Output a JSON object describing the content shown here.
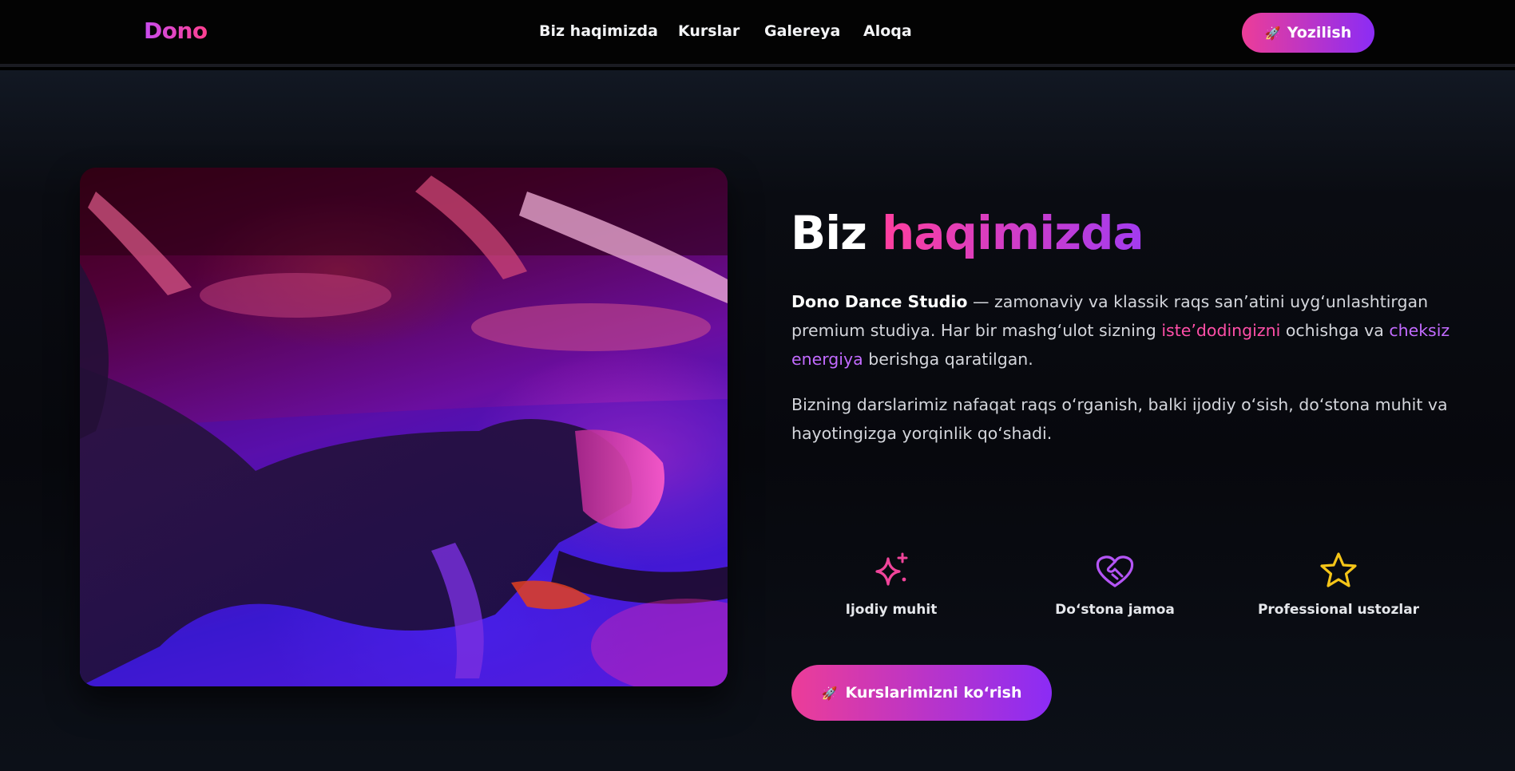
{
  "brand": {
    "name": "Dono",
    "gradient": [
      "#c84cf0",
      "#ff3f8e"
    ]
  },
  "nav": {
    "items": [
      "Biz haqimizda",
      "Kurslar",
      "Galereya",
      "Aloqa"
    ]
  },
  "header_button": {
    "icon": "rocket-icon",
    "emoji": "🚀",
    "label": "Yozilish"
  },
  "about": {
    "title_plain": "Biz ",
    "title_accent": "haqimizda",
    "paragraph1": {
      "strong": "Dono Dance Studio",
      "part1": " — zamonaviy va klassik raqs san’atini uyg‘unlashtirgan premium studiya. Har bir mashg‘ulot sizning ",
      "highlight1": "iste’dodingizni",
      "part2": " ochishga va ",
      "highlight2": "cheksiz energiya",
      "part3": " berishga qaratilgan."
    },
    "paragraph2": "Bizning darslarimiz nafaqat raqs o‘rganish, balki ijodiy o‘sish, do‘stona muhit va hayotingizga yorqinlik qo‘shadi.",
    "photo_alt": "dance-photo",
    "features": [
      {
        "icon": "sparkles-icon",
        "label": "Ijodiy muhit",
        "color": "#f0449a"
      },
      {
        "icon": "heart-handshake-icon",
        "label": "Do‘stona jamoa",
        "color": "#b455f5"
      },
      {
        "icon": "star-icon",
        "label": "Professional ustozlar",
        "color": "#f5c518"
      }
    ],
    "cta": {
      "icon": "rocket-icon",
      "emoji": "🚀",
      "label": "Kurslarimizni ko‘rish"
    }
  },
  "colors": {
    "accent_pink": "#ec3d98",
    "accent_purple": "#8b2cf5",
    "highlight_pink": "#ff4fa8",
    "highlight_purple": "#c26bff",
    "background": "#07080d"
  }
}
